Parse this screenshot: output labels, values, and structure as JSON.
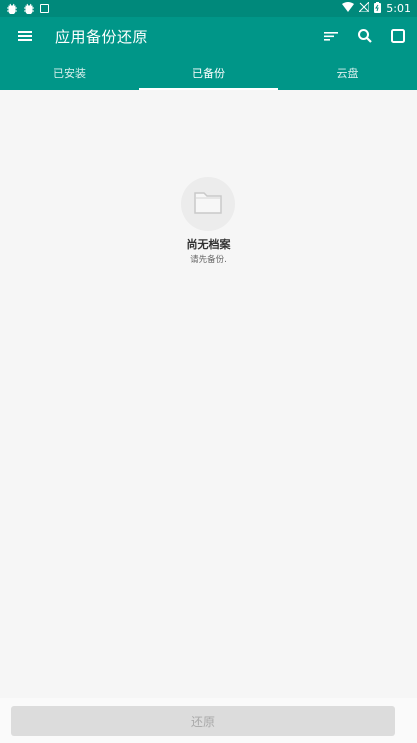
{
  "status_bar": {
    "time": "5:01",
    "left_icons": [
      "bug-icon",
      "bug-icon",
      "notification-icon"
    ],
    "right_icons": [
      "wifi-icon",
      "no-signal-icon",
      "battery-charging-icon"
    ]
  },
  "toolbar": {
    "title": "应用备份还原",
    "menu_icon": "menu-icon",
    "sort_icon": "sort-icon",
    "search_icon": "search-icon",
    "select_icon": "select-all-icon"
  },
  "tabs": [
    {
      "label": "已安装",
      "active": false
    },
    {
      "label": "已备份",
      "active": true
    },
    {
      "label": "云盘",
      "active": false
    }
  ],
  "empty_state": {
    "icon": "folder-icon",
    "title": "尚无档案",
    "subtitle": "请先备份."
  },
  "bottom": {
    "restore_label": "还原",
    "enabled": false
  },
  "colors": {
    "primary": "#009688",
    "status_bar": "#00897b",
    "background": "#f6f6f6",
    "disabled_button": "#dcdcdc"
  }
}
